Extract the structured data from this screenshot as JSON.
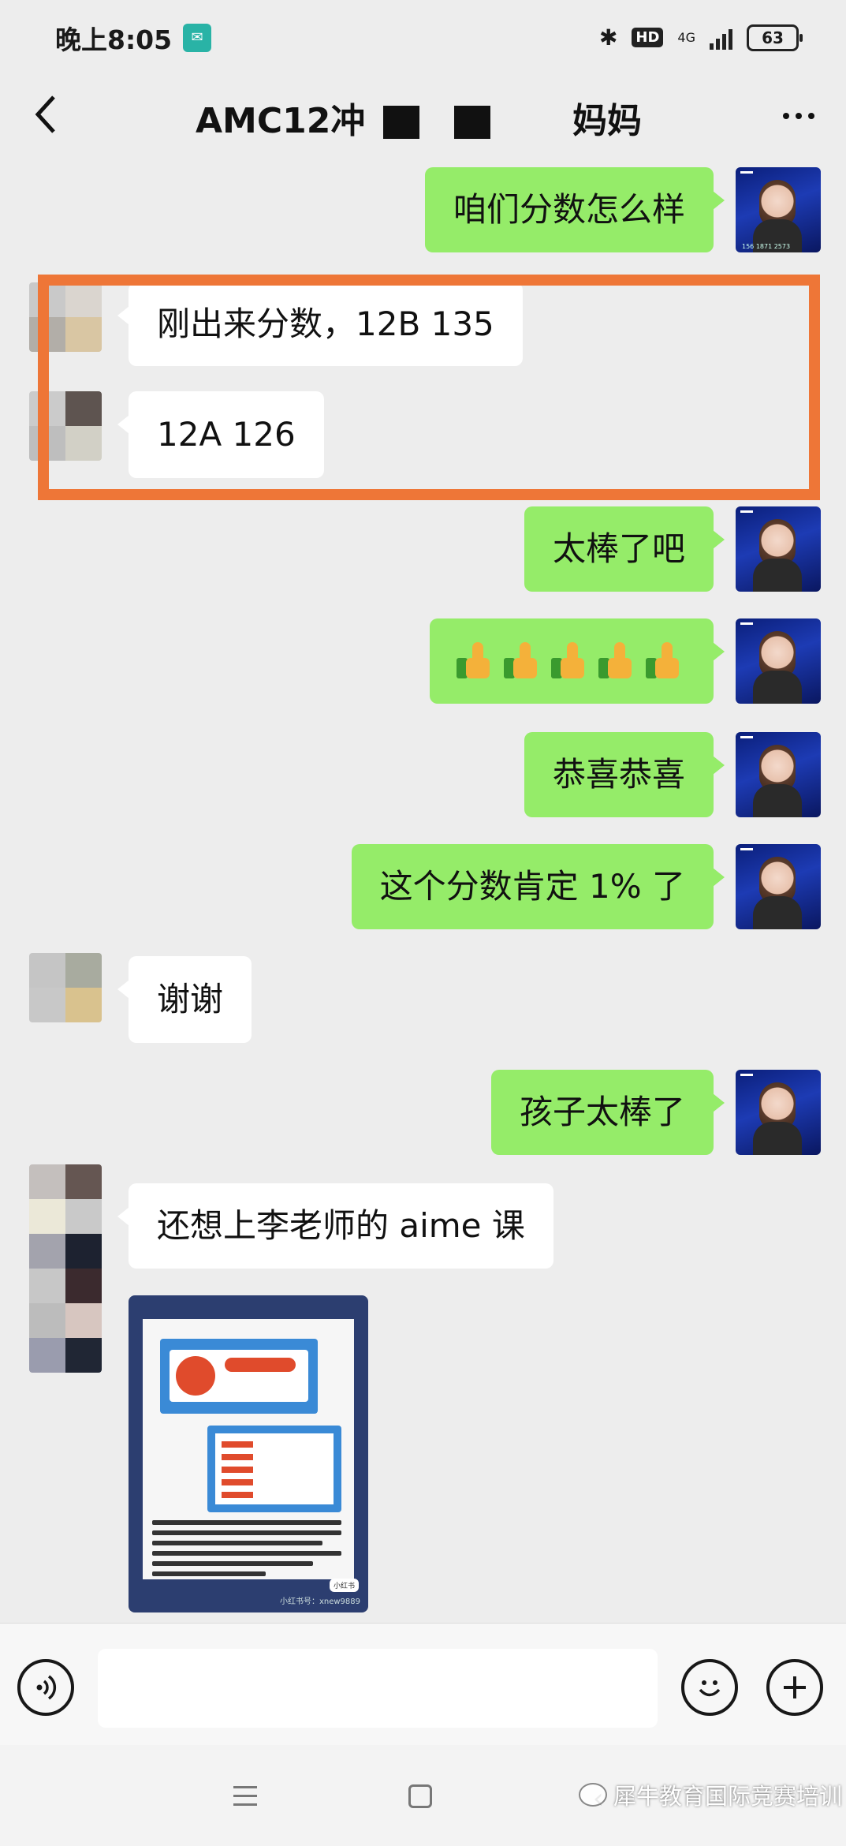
{
  "status_bar": {
    "time": "晚上8:05",
    "network": "4G",
    "hd": "HD",
    "battery": "63"
  },
  "header": {
    "title": "AMC12冲",
    "title_suffix": "妈妈"
  },
  "messages": [
    {
      "side": "self",
      "text": "咱们分数怎么样"
    },
    {
      "side": "other",
      "text": "刚出来分数，12B 135"
    },
    {
      "side": "other",
      "text": "12A 126"
    },
    {
      "side": "self",
      "text": "太棒了吧"
    },
    {
      "side": "self",
      "emoji": "thumbs-up",
      "count": 5
    },
    {
      "side": "self",
      "text": "恭喜恭喜"
    },
    {
      "side": "self",
      "text": "这个分数肯定 1% 了"
    },
    {
      "side": "other",
      "text": "谢谢"
    },
    {
      "side": "self",
      "text": "孩子太棒了"
    },
    {
      "side": "other",
      "text": "还想上李老师的 aime 课"
    },
    {
      "side": "other",
      "image": "course-poster"
    }
  ],
  "image_card": {
    "tag": "小红书",
    "footer": "小红书号：xnew9889"
  },
  "self_avatar": {
    "phone": "156 1871 2573"
  },
  "input_bar": {
    "voice_icon": "voice-icon",
    "emoji_icon": "emoji-icon",
    "plus_icon": "plus-icon"
  },
  "watermark": "犀牛教育国际竞赛培训",
  "colors": {
    "self_bubble": "#95ec69",
    "other_bubble": "#ffffff",
    "highlight": "#ee7637",
    "background": "#ededed"
  }
}
